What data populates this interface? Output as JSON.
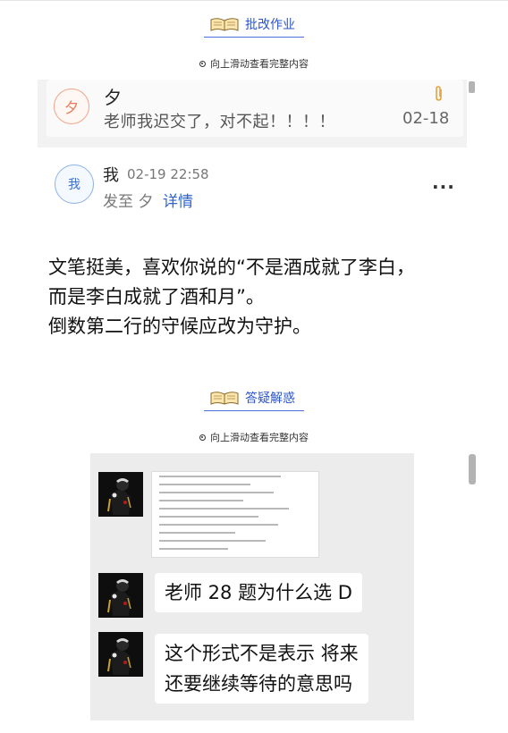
{
  "section1": {
    "title": "批改作业",
    "hint": "向上滑动查看完整内容"
  },
  "message": {
    "avatar_char": "夕",
    "sender": "夕",
    "text": "老师我迟交了，对不起！！！！",
    "date": "02-18"
  },
  "reply": {
    "avatar_char": "我",
    "sender": "我",
    "time": "02-19 22:58",
    "sent_to": "发至 夕",
    "detail_link": "详情",
    "more": "···"
  },
  "comment": {
    "lines": [
      "文笔挺美，喜欢你说的“不是酒成就了李白，",
      "而是李白成就了酒和月”。",
      "倒数第二行的守候应改为守护。"
    ]
  },
  "section2": {
    "title": "答疑解惑",
    "hint": "向上滑动查看完整内容"
  },
  "chat": {
    "messages": [
      {
        "lines": [
          "老师 28 题为什么选 D"
        ]
      },
      {
        "lines": [
          "这个形式不是表示 将来",
          "还要继续等待的意思吗"
        ]
      }
    ]
  },
  "colors": {
    "accent": "#2c55c9",
    "link": "#2d64d0",
    "avatar_orange": "#e8795a",
    "chat_bg": "#ececec"
  },
  "icons": {
    "section": "book-icon",
    "hint": "circle-dot-icon",
    "attachment": "paperclip-icon",
    "more": "more-dots-icon"
  }
}
